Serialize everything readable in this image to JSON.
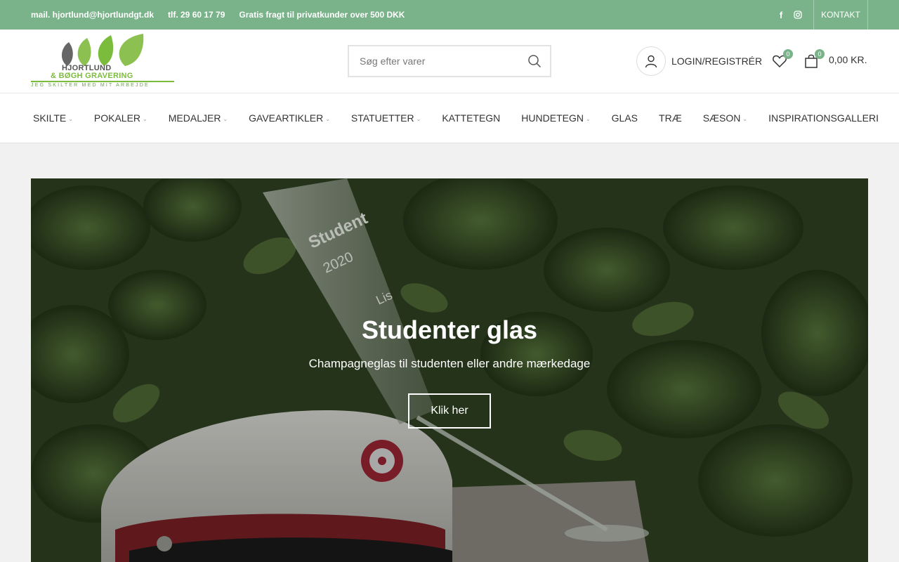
{
  "topbar": {
    "email": "mail. hjortlund@hjortlundgt.dk",
    "phone": "tlf. 29 60 17 79",
    "shipping": "Gratis fragt til privatkunder over 500 DKK",
    "facebook_glyph": "f",
    "kontakt": "KONTAKT"
  },
  "logo": {
    "line1": "HJORTLUND",
    "line2": "& BØGH GRAVERING",
    "tagline": "JEG SKILTER MED MIT ARBEJDE"
  },
  "search": {
    "placeholder": "Søg efter varer"
  },
  "account": {
    "label": "LOGIN/REGISTRÉR"
  },
  "wishlist": {
    "count": "0"
  },
  "cart": {
    "count": "0",
    "total": "0,00 KR."
  },
  "nav": {
    "items": [
      {
        "label": "SKILTE",
        "dropdown": true
      },
      {
        "label": "POKALER",
        "dropdown": true
      },
      {
        "label": "MEDALJER",
        "dropdown": true
      },
      {
        "label": "GAVEARTIKLER",
        "dropdown": true
      },
      {
        "label": "STATUETTER",
        "dropdown": true
      },
      {
        "label": "KATTETEGN",
        "dropdown": false
      },
      {
        "label": "HUNDETEGN",
        "dropdown": true
      },
      {
        "label": "GLAS",
        "dropdown": false
      },
      {
        "label": "TRÆ",
        "dropdown": false
      },
      {
        "label": "SÆSON",
        "dropdown": true
      },
      {
        "label": "INSPIRATIONSGALLERI",
        "dropdown": false
      }
    ]
  },
  "hero": {
    "title": "Studenter glas",
    "subtitle": "Champagneglas til studenten eller andre mærkedage",
    "button": "Klik her",
    "glass_text": [
      "Student",
      "2020",
      "Lis"
    ]
  },
  "colors": {
    "accent": "#7ab38a",
    "logo_green": "#7cbc3c"
  }
}
